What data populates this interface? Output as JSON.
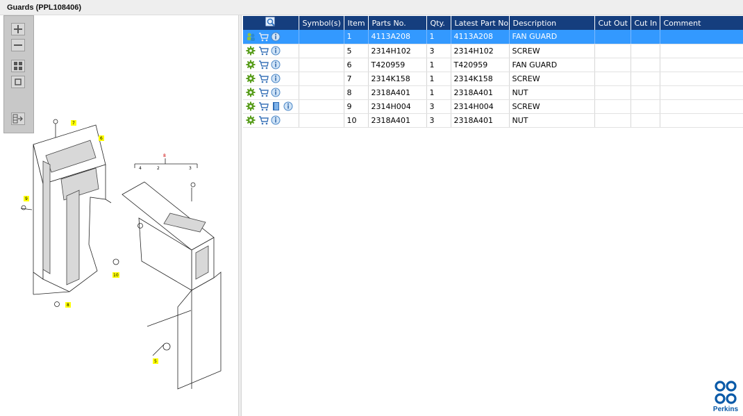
{
  "window": {
    "title": "Guards (PPL108406)"
  },
  "toolbox": {
    "items": [
      {
        "name": "zoom-in-icon"
      },
      {
        "name": "zoom-out-icon"
      },
      {
        "name": "fit-all-icon"
      },
      {
        "name": "fit-window-icon"
      },
      {
        "name": "export-icon"
      }
    ]
  },
  "drawing": {
    "callouts": [
      "7",
      "6",
      "9",
      "10",
      "8",
      "5"
    ],
    "assembly_labels": [
      "4",
      "2",
      "3"
    ],
    "group_label": "8",
    "callout_color": "#ffff00"
  },
  "table": {
    "header_icon": "magnifier-icon",
    "columns": [
      "",
      "Symbol(s)",
      "Item",
      "Parts No.",
      "Qty.",
      "Latest Part No.",
      "Description",
      "Cut Out",
      "Cut In",
      "Comment"
    ],
    "rows": [
      {
        "item": "1",
        "part_no": "4113A208",
        "qty": "1",
        "latest": "4113A208",
        "description": "FAN GUARD",
        "cut_out": "",
        "cut_in": "",
        "comment": "",
        "selected": true,
        "has_book": false
      },
      {
        "item": "5",
        "part_no": "2314H102",
        "qty": "3",
        "latest": "2314H102",
        "description": "SCREW",
        "cut_out": "",
        "cut_in": "",
        "comment": "",
        "selected": false,
        "has_book": false
      },
      {
        "item": "6",
        "part_no": "T420959",
        "qty": "1",
        "latest": "T420959",
        "description": "FAN GUARD",
        "cut_out": "",
        "cut_in": "",
        "comment": "",
        "selected": false,
        "has_book": false
      },
      {
        "item": "7",
        "part_no": "2314K158",
        "qty": "1",
        "latest": "2314K158",
        "description": "SCREW",
        "cut_out": "",
        "cut_in": "",
        "comment": "",
        "selected": false,
        "has_book": false
      },
      {
        "item": "8",
        "part_no": "2318A401",
        "qty": "1",
        "latest": "2318A401",
        "description": "NUT",
        "cut_out": "",
        "cut_in": "",
        "comment": "",
        "selected": false,
        "has_book": false
      },
      {
        "item": "9",
        "part_no": "2314H004",
        "qty": "3",
        "latest": "2314H004",
        "description": "SCREW",
        "cut_out": "",
        "cut_in": "",
        "comment": "",
        "selected": false,
        "has_book": true
      },
      {
        "item": "10",
        "part_no": "2318A401",
        "qty": "3",
        "latest": "2318A401",
        "description": "NUT",
        "cut_out": "",
        "cut_in": "",
        "comment": "",
        "selected": false,
        "has_book": false
      }
    ]
  },
  "colors": {
    "header_bg": "#153e7e",
    "selected_bg": "#3399ff",
    "brand": "#0a5aa8"
  },
  "logo": {
    "brand": "Perkins"
  }
}
